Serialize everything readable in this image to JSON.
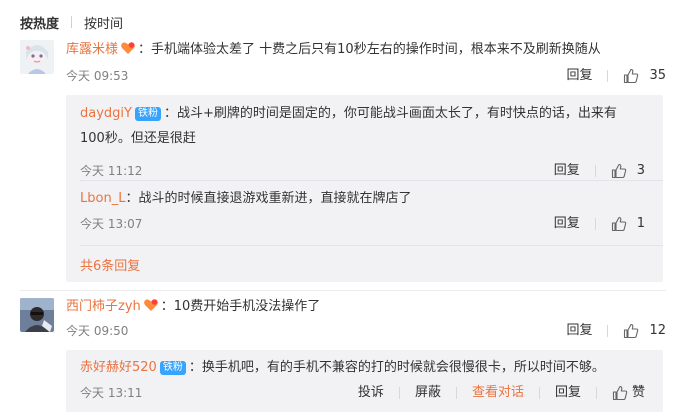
{
  "sort": {
    "hot": "按热度",
    "time": "按时间"
  },
  "comments": [
    {
      "user": "库露米様",
      "text": "：手机端体验太差了 十费之后只有10秒左右的操作时间，根本来不及刷新换随从",
      "time": "今天 09:53",
      "reply_label": "回复",
      "likes": "35",
      "replies": [
        {
          "user": "daydgiY",
          "badge": "铁粉",
          "text_line1": "：战斗+刷牌的时间是固定的，你可能战斗画面太长了，有时快点的话，出来有",
          "text_line2": "100秒。但还是很赶",
          "time": "今天 11:12",
          "reply_label": "回复",
          "likes": "3"
        },
        {
          "user": "Lbon_L",
          "text": "：战斗的时候直接退游戏重新进，直接就在牌店了",
          "time": "今天 13:07",
          "reply_label": "回复",
          "likes": "1"
        }
      ],
      "more_replies": "共6条回复"
    },
    {
      "user": "西门柿子zyh",
      "text": "：10费开始手机没法操作了",
      "time": "今天 09:50",
      "reply_label": "回复",
      "likes": "12",
      "replies": [
        {
          "user": "赤好赫好520",
          "badge": "铁粉",
          "text": "：换手机吧，有的手机不兼容的打的时候就会很慢很卡，所以时间不够。",
          "time": "今天 13:11",
          "report": "投诉",
          "block": "屏蔽",
          "view_conversation": "查看对话",
          "reply_label": "回复",
          "like_label": "赞"
        }
      ]
    }
  ],
  "colors": {
    "username": "#eb7340",
    "badge": "#36a3ff",
    "reply_bg": "#f2f2f5"
  }
}
